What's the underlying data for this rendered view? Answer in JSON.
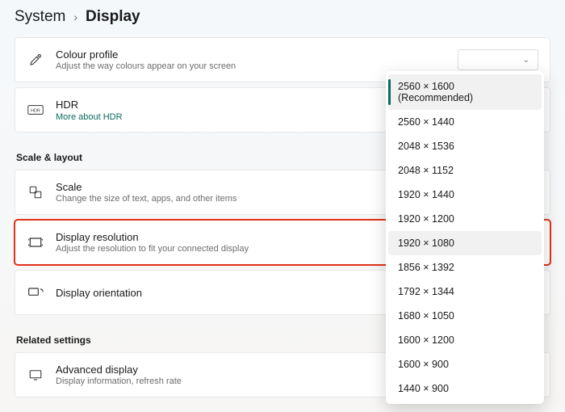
{
  "breadcrumb": {
    "parent": "System",
    "current": "Display"
  },
  "cards": {
    "colour_profile": {
      "title": "Colour profile",
      "sub": "Adjust the way colours appear on your screen"
    },
    "hdr": {
      "title": "HDR",
      "link": "More about HDR"
    },
    "scale": {
      "title": "Scale",
      "sub": "Change the size of text, apps, and other items"
    },
    "resolution": {
      "title": "Display resolution",
      "sub": "Adjust the resolution to fit your connected display"
    },
    "orientation": {
      "title": "Display orientation"
    },
    "advanced": {
      "title": "Advanced display",
      "sub": "Display information, refresh rate"
    }
  },
  "sections": {
    "scale_layout": "Scale & layout",
    "related": "Related settings"
  },
  "resolution_menu": {
    "selected_index": 0,
    "hover_index": 6,
    "items": [
      "2560 × 1600 (Recommended)",
      "2560 × 1440",
      "2048 × 1536",
      "2048 × 1152",
      "1920 × 1440",
      "1920 × 1200",
      "1920 × 1080",
      "1856 × 1392",
      "1792 × 1344",
      "1680 × 1050",
      "1600 × 1200",
      "1600 × 900",
      "1440 × 900"
    ]
  }
}
